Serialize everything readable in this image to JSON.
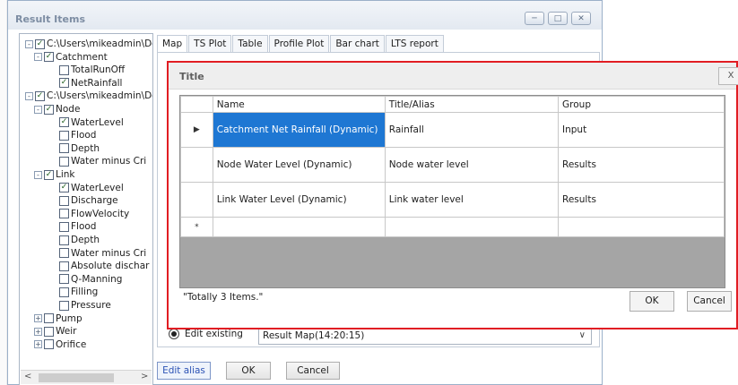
{
  "window": {
    "title": "Result Items",
    "minimize_icon": "minimize-icon",
    "maximize_icon": "maximize-icon",
    "close_icon": "close-icon"
  },
  "tree": {
    "nodes": [
      {
        "label": "C:\\Users\\mikeadmin\\Doc",
        "level": 0,
        "expander": "-",
        "checked": true
      },
      {
        "label": "Catchment",
        "level": 1,
        "expander": "-",
        "checked": true
      },
      {
        "label": "TotalRunOff",
        "level": 2,
        "expander": "",
        "checked": false
      },
      {
        "label": "NetRainfall",
        "level": 2,
        "expander": "",
        "checked": true
      },
      {
        "label": "C:\\Users\\mikeadmin\\Doc",
        "level": 0,
        "expander": "-",
        "checked": true
      },
      {
        "label": "Node",
        "level": 1,
        "expander": "-",
        "checked": true
      },
      {
        "label": "WaterLevel",
        "level": 2,
        "expander": "",
        "checked": true
      },
      {
        "label": "Flood",
        "level": 2,
        "expander": "",
        "checked": false
      },
      {
        "label": "Depth",
        "level": 2,
        "expander": "",
        "checked": false
      },
      {
        "label": "Water minus Cri",
        "level": 2,
        "expander": "",
        "checked": false
      },
      {
        "label": "Link",
        "level": 1,
        "expander": "-",
        "checked": true
      },
      {
        "label": "WaterLevel",
        "level": 2,
        "expander": "",
        "checked": true
      },
      {
        "label": "Discharge",
        "level": 2,
        "expander": "",
        "checked": false
      },
      {
        "label": "FlowVelocity",
        "level": 2,
        "expander": "",
        "checked": false
      },
      {
        "label": "Flood",
        "level": 2,
        "expander": "",
        "checked": false
      },
      {
        "label": "Depth",
        "level": 2,
        "expander": "",
        "checked": false
      },
      {
        "label": "Water minus Cri",
        "level": 2,
        "expander": "",
        "checked": false
      },
      {
        "label": "Absolute dischar",
        "level": 2,
        "expander": "",
        "checked": false
      },
      {
        "label": "Q-Manning",
        "level": 2,
        "expander": "",
        "checked": false
      },
      {
        "label": "Filling",
        "level": 2,
        "expander": "",
        "checked": false
      },
      {
        "label": "Pressure",
        "level": 2,
        "expander": "",
        "checked": false
      },
      {
        "label": "Pump",
        "level": 1,
        "expander": "+",
        "checked": false
      },
      {
        "label": "Weir",
        "level": 1,
        "expander": "+",
        "checked": false
      },
      {
        "label": "Orifice",
        "level": 1,
        "expander": "+",
        "checked": false
      }
    ],
    "scroll_left": "<",
    "scroll_right": ">"
  },
  "tabs": [
    "Map",
    "TS Plot",
    "Table",
    "Profile Plot",
    "Bar chart",
    "LTS report"
  ],
  "edit_existing": {
    "label": "Edit existing",
    "value": "Result Map(14:20:15)",
    "chevron": "∨"
  },
  "buttons": {
    "edit_alias": "Edit alias",
    "ok": "OK",
    "cancel": "Cancel"
  },
  "dialog": {
    "title": "Title",
    "close_label": "X",
    "columns": [
      "Name",
      "Title/Alias",
      "Group"
    ],
    "rows": [
      {
        "marker": "▶",
        "name": "Catchment Net Rainfall (Dynamic)",
        "alias": "Rainfall",
        "group": "Input"
      },
      {
        "marker": "",
        "name": "Node Water Level (Dynamic)",
        "alias": "Node water level",
        "group": "Results"
      },
      {
        "marker": "",
        "name": "Link Water Level (Dynamic)",
        "alias": "Link water level",
        "group": "Results"
      }
    ],
    "new_row_marker": "*",
    "status": "\"Totally 3 Items.\"",
    "ok": "OK",
    "cancel": "Cancel"
  },
  "colors": {
    "highlight_border": "#e11d23",
    "selected_cell": "#1e77d3",
    "grid_background": "#a5a5a5"
  }
}
